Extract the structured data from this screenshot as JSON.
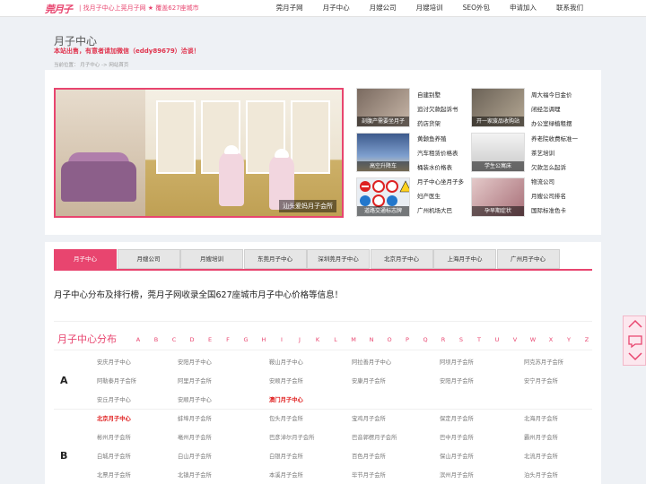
{
  "topbar": {
    "logo": "莞月子",
    "slogan": "| 找月子中心上莞月子网 ★ 覆盖627座城市",
    "nav": [
      "莞月子网",
      "月子中心",
      "月嫂公司",
      "月嫂培训",
      "SEO外包",
      "申请加入",
      "联系我们"
    ]
  },
  "header": {
    "title": "月子中心",
    "notice": "本站出售，有意者请加微信（eddy89679）洽谈！",
    "breadcrumb": "当前位置：  月子中心 -> 网站首页"
  },
  "slider": {
    "caption": "汕头爱妈月子会所"
  },
  "news": {
    "pics": [
      "剖腹产需要坐月子",
      "开一家废品收购站",
      "高空升降车",
      "学生公寓床",
      "道路交通标志牌",
      "孕早期症状"
    ],
    "col1": [
      "自建别墅",
      "追讨欠款起诉书",
      "药店货架",
      "黄颡鱼养殖",
      "汽车租赁价格表",
      "桶装水价格表",
      "月子中心坐月子多",
      "妇产医生",
      "广州机场大巴"
    ],
    "col2": [
      "周大福今日金价",
      "闭经怎调理",
      "办公室绿植租摆",
      "养老院收费标准一",
      "茶艺培训",
      "欠款怎么起诉",
      "物流公司",
      "月嫂公司排名",
      "国际标准色卡"
    ]
  },
  "tabs": [
    "月子中心",
    "月嫂公司",
    "月嫂培训",
    "东莞月子中心",
    "深圳莞月子中心",
    "北京月子中心",
    "上海月子中心",
    "广州月子中心"
  ],
  "intro": "月子中心分布及排行榜，莞月子网收录全国627座城市月子中心价格等信息！",
  "distribution": {
    "title": "月子中心分布",
    "letters": [
      "A",
      "B",
      "C",
      "D",
      "E",
      "F",
      "G",
      "H",
      "I",
      "J",
      "K",
      "L",
      "M",
      "N",
      "O",
      "P",
      "Q",
      "R",
      "S",
      "T",
      "U",
      "V",
      "W",
      "X",
      "Y",
      "Z"
    ],
    "groups": [
      {
        "letter": "A",
        "rows": [
          [
            "安庆月子中心",
            "安阳月子中心",
            "鞍山月子中心",
            "阿拉善月子中心",
            "阿坝月子会所",
            "阿克苏月子会所"
          ],
          [
            "阿勒泰月子会所",
            "阿里月子会所",
            "安顺月子会所",
            "安康月子会所",
            "安阳月子会所",
            "安宁月子会所"
          ],
          [
            "安丘月子中心",
            "安顺月子中心",
            "澳门月子中心"
          ]
        ]
      },
      {
        "letter": "B",
        "rows": [
          [
            "北京月子中心",
            "蚌埠月子会所",
            "包头月子会所",
            "宝鸡月子会所",
            "保定月子会所",
            "北海月子会所"
          ],
          [
            "彬州月子会所",
            "亳州月子会所",
            "巴彦淖尔月子会所",
            "巴音郭楞月子会所",
            "巴中月子会所",
            "霸州月子会所"
          ],
          [
            "白城月子会所",
            "白山月子会所",
            "白银月子会所",
            "百色月子会所",
            "保山月子会所",
            "北流月子会所"
          ],
          [
            "北票月子会所",
            "北镇月子会所",
            "本溪月子会所",
            "毕节月子会所",
            "滨州月子会所",
            "泊头月子会所"
          ]
        ]
      }
    ]
  },
  "colors": {
    "accent": "#e8456f",
    "hot": "#e02020"
  }
}
